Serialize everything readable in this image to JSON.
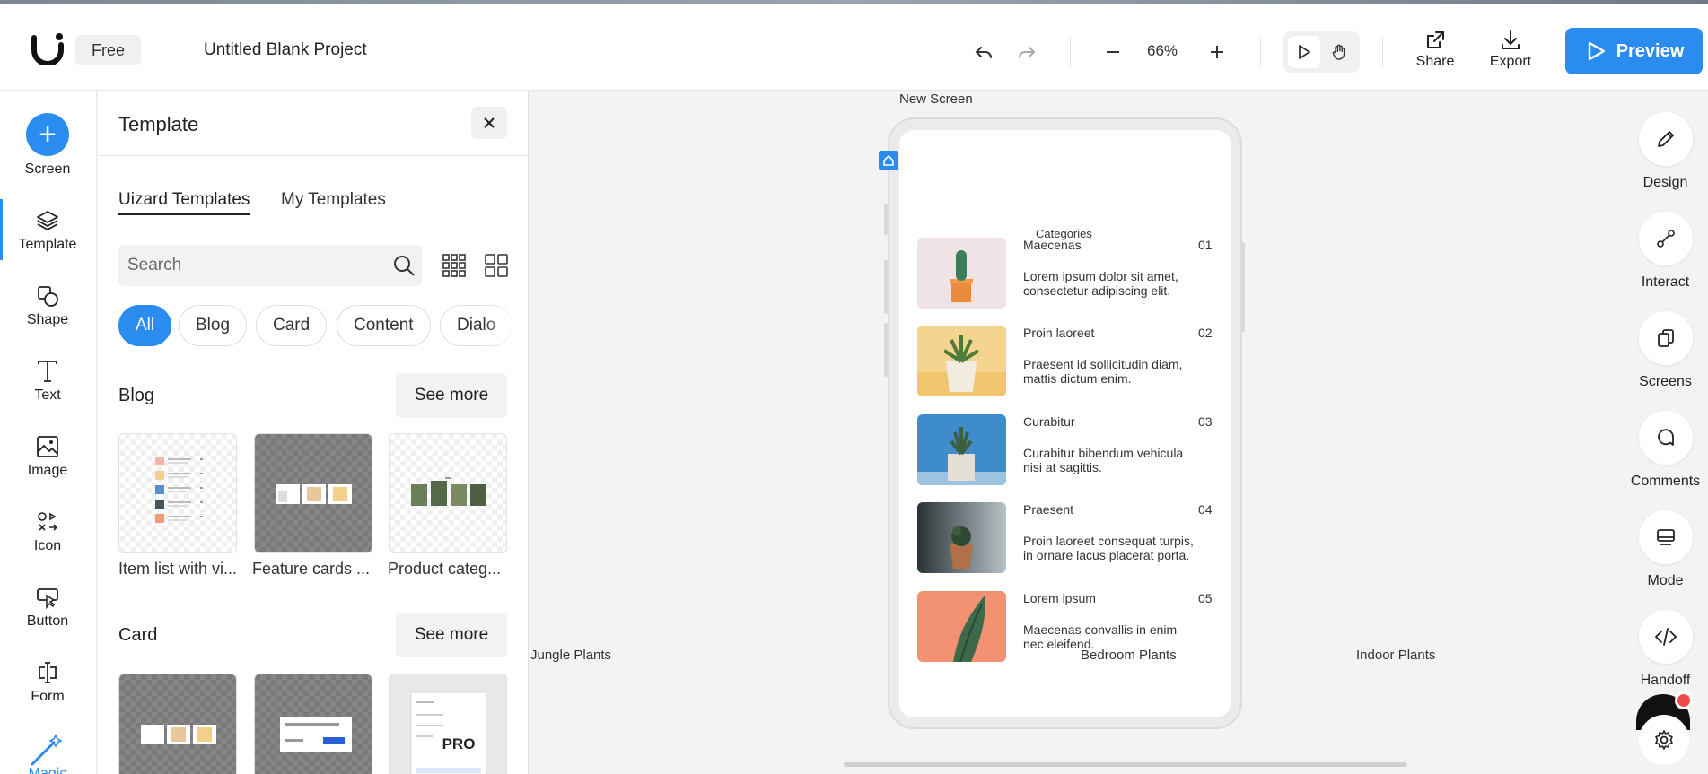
{
  "topbar": {
    "plan": "Free",
    "project_title": "Untitled Blank Project",
    "zoom": "66%",
    "share_label": "Share",
    "export_label": "Export",
    "preview_label": "Preview"
  },
  "left_rail": {
    "items": [
      {
        "label": "Screen",
        "icon": "plus-icon"
      },
      {
        "label": "Template",
        "icon": "layers-icon"
      },
      {
        "label": "Shape",
        "icon": "shapes-icon"
      },
      {
        "label": "Text",
        "icon": "text-icon"
      },
      {
        "label": "Image",
        "icon": "image-icon"
      },
      {
        "label": "Icon",
        "icon": "icons-icon"
      },
      {
        "label": "Button",
        "icon": "button-icon"
      },
      {
        "label": "Form",
        "icon": "form-icon"
      },
      {
        "label": "Magic",
        "icon": "magic-wand-icon"
      }
    ],
    "active": "Template"
  },
  "panel": {
    "title": "Template",
    "tabs": [
      "Uizard Templates",
      "My Templates"
    ],
    "active_tab": "Uizard Templates",
    "search_placeholder": "Search",
    "chips": [
      "All",
      "Blog",
      "Card",
      "Content",
      "Dialo"
    ],
    "active_chip": "All",
    "sections": [
      {
        "title": "Blog",
        "see_more": "See more",
        "items": [
          "Item list with vi...",
          "Feature cards ...",
          "Product categ..."
        ]
      },
      {
        "title": "Card",
        "see_more": "See more",
        "items": [
          "",
          "",
          ""
        ],
        "pro_badge": "PRO"
      }
    ]
  },
  "canvas": {
    "screen_label": "New Screen",
    "categories_heading": "Categories",
    "list": [
      {
        "title": "Maecenas",
        "num": "01",
        "desc": "Lorem ipsum dolor sit amet, consectetur adipiscing elit."
      },
      {
        "title": "Proin laoreet",
        "num": "02",
        "desc": "Praesent id sollicitudin diam, mattis dictum enim."
      },
      {
        "title": "Curabitur",
        "num": "03",
        "desc": "Curabitur bibendum vehicula nisi at sagittis."
      },
      {
        "title": "Praesent",
        "num": "04",
        "desc": "Proin laoreet consequat turpis, in ornare lacus placerat porta."
      },
      {
        "title": "Lorem ipsum",
        "num": "05",
        "desc": "Maecenas convallis in enim nec eleifend."
      }
    ],
    "floating_labels": [
      "Jungle Plants",
      "Bedroom Plants",
      "Indoor Plants"
    ]
  },
  "right_rail": {
    "items": [
      "Design",
      "Interact",
      "Screens",
      "Comments",
      "Mode",
      "Handoff"
    ]
  },
  "colors": {
    "accent": "#2b8cf0",
    "notification": "#f04a4a"
  }
}
